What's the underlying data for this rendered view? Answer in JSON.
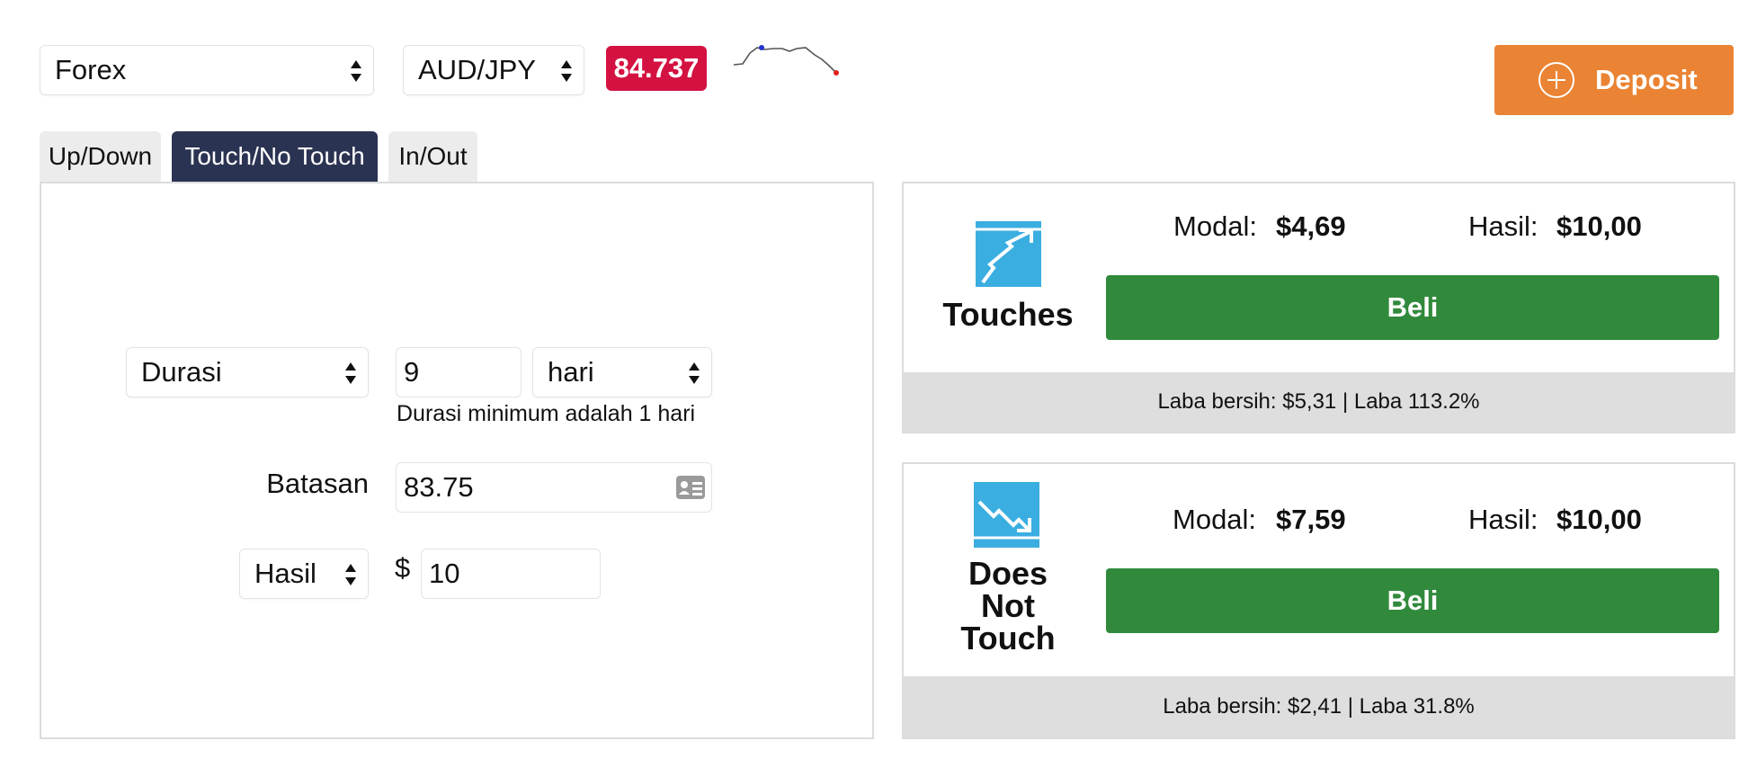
{
  "header": {
    "market_select": "Forex",
    "asset_select": "AUD/JPY",
    "spot_price": "84.737",
    "deposit_label": "Deposit"
  },
  "tabs": [
    {
      "label": "Up/Down"
    },
    {
      "label": "Touch/No Touch"
    },
    {
      "label": "In/Out"
    }
  ],
  "form": {
    "duration_select": "Durasi",
    "duration_value": "9",
    "duration_unit": "hari",
    "duration_hint": "Durasi minimum adalah 1 hari",
    "barrier_label": "Batasan",
    "barrier_value": "83.75",
    "payout_select": "Hasil",
    "currency_symbol": "$",
    "payout_value": "10"
  },
  "contracts": [
    {
      "title": "Touches",
      "stake_label": "Modal:",
      "stake_value": "$4,69",
      "payout_label": "Hasil:",
      "payout_value": "$10,00",
      "buy_label": "Beli",
      "footer": "Laba bersih: $5,31 | Laba 113.2%"
    },
    {
      "title": "Does Not Touch",
      "title_lines": [
        "Does",
        "Not",
        "Touch"
      ],
      "stake_label": "Modal:",
      "stake_value": "$7,59",
      "payout_label": "Hasil:",
      "payout_value": "$10,00",
      "buy_label": "Beli",
      "footer": "Laba bersih: $2,41 | Laba 31.8%"
    }
  ],
  "colors": {
    "spot_bg": "#d41241",
    "deposit_bg": "#ea8333",
    "active_tab_bg": "#2b3352",
    "buy_bg": "#318a3c",
    "contract_icon_bg": "#3aaee0"
  },
  "icons": {
    "select_arrows": "up-down-arrows-icon",
    "barrier_picker": "id-card-icon",
    "deposit": "plus-circle-icon",
    "touches": "touch-up-icon",
    "no_touch": "no-touch-down-icon",
    "sparkline": "price-sparkline"
  }
}
